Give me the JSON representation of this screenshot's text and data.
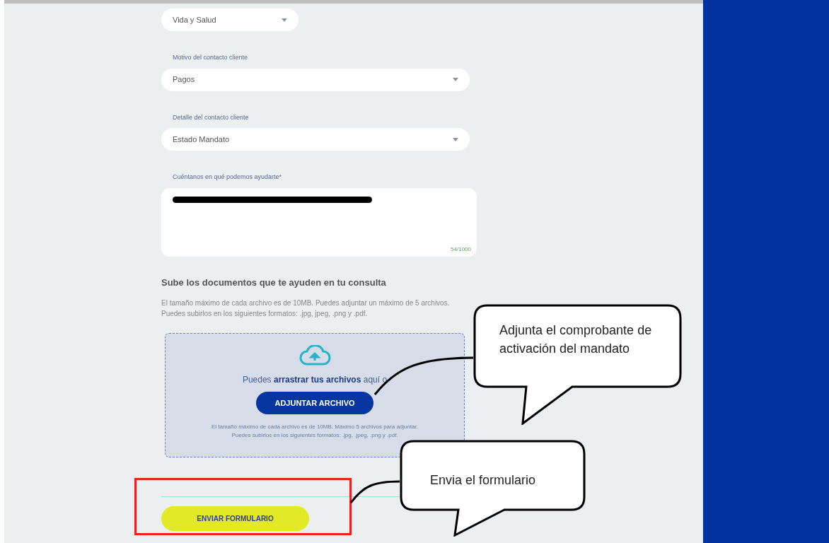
{
  "fields": [
    {
      "kind": "select",
      "value": "Vida y Salud"
    },
    {
      "kind": "select",
      "label": "Motivo del contacto cliente",
      "value": "Pagos"
    },
    {
      "kind": "select",
      "label": "Detalle del contacto cliente",
      "value": "Estado Mandato"
    },
    {
      "kind": "textarea",
      "label": "Cuéntanos en qué podemos ayudarte*",
      "redacted": true,
      "counter": "54/1000"
    }
  ],
  "upload": {
    "title": "Sube los documentos que te ayuden en tu consulta",
    "description": [
      "El tamaño máximo de cada archivo es de 10MB. Puedes adjuntar un máximo de 5 archivos.",
      "Puedes subirlos en los siguientes formatos: .jpg, jpeg, .png y .pdf."
    ],
    "drop_text": "Puedes **arrastrar tus archivos** aquí o",
    "button": "ADJUNTAR ARCHIVO",
    "hint": [
      "El tamaño máximo de cada archivo es de 10MB. Máximo 5 archivos para adjuntar.",
      "Puedes subirlos en los siguientes formatos: .jpg, .jpeg, .png y .pdf."
    ]
  },
  "submit": {
    "label": "ENVIAR FORMULARIO",
    "highlighted": true
  },
  "callouts": [
    {
      "text": "Adjunta el comprobante de activación del mandato"
    },
    {
      "text": "Envia el formulario"
    }
  ]
}
